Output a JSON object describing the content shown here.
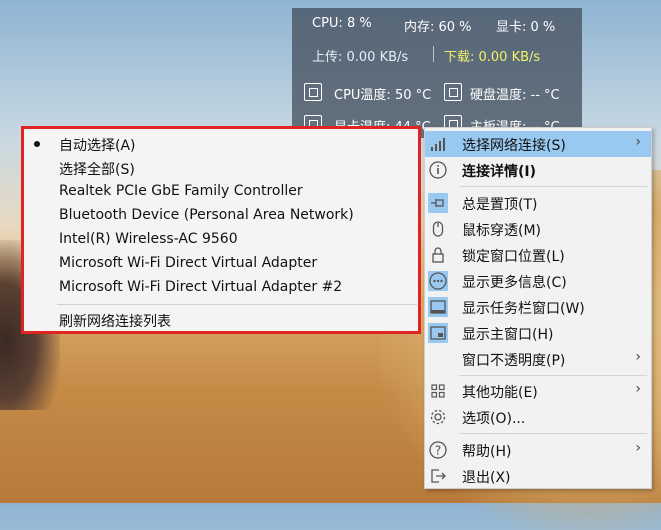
{
  "monitor": {
    "cpu": "CPU: 8 %",
    "memory": "内存: 60 %",
    "gpu": "显卡: 0 %",
    "upload": "上传: 0.00 KB/s",
    "download": "下载: 0.00 KB/s",
    "cpu_temp": "CPU温度: 50 °C",
    "disk_temp": "硬盘温度: -- °C",
    "gpu_temp": "显卡温度: 44 °C",
    "board_temp": "主板温度: -- °C"
  },
  "context_menu": {
    "items": [
      {
        "label": "选择网络连接(S)",
        "icon": "signal-bars-icon",
        "submenu": true,
        "highlighted": true
      },
      {
        "label": "连接详情(I)",
        "icon": "info-icon",
        "bold": true
      },
      {
        "label": "总是置顶(T)",
        "icon": "pin-icon",
        "checked": true
      },
      {
        "label": "鼠标穿透(M)",
        "icon": "mouse-icon"
      },
      {
        "label": "锁定窗口位置(L)",
        "icon": "lock-icon"
      },
      {
        "label": "显示更多信息(C)",
        "icon": "more-info-icon",
        "checked": true
      },
      {
        "label": "显示任务栏窗口(W)",
        "icon": "taskbar-window-icon",
        "checked": true
      },
      {
        "label": "显示主窗口(H)",
        "icon": "main-window-icon",
        "checked": true
      },
      {
        "label": "窗口不透明度(P)",
        "icon": "",
        "submenu": true
      },
      {
        "label": "其他功能(E)",
        "icon": "grid-icon",
        "submenu": true
      },
      {
        "label": "选项(O)...",
        "icon": "gear-icon"
      },
      {
        "label": "帮助(H)",
        "icon": "help-icon",
        "submenu": true
      },
      {
        "label": "退出(X)",
        "icon": "exit-icon"
      }
    ]
  },
  "network_submenu": {
    "items": [
      {
        "label": "自动选择(A)",
        "selected": true
      },
      {
        "label": "选择全部(S)"
      },
      {
        "label": "Realtek PCIe GbE Family Controller"
      },
      {
        "label": "Bluetooth Device (Personal Area Network)"
      },
      {
        "label": "Intel(R) Wireless-AC 9560"
      },
      {
        "label": "Microsoft Wi-Fi Direct Virtual Adapter"
      },
      {
        "label": "Microsoft Wi-Fi Direct Virtual Adapter #2"
      }
    ],
    "refresh_label": "刷新网络连接列表"
  },
  "colors": {
    "highlight": "#99c9f0",
    "border_red": "#e02323",
    "download_text": "#f3f06a"
  }
}
